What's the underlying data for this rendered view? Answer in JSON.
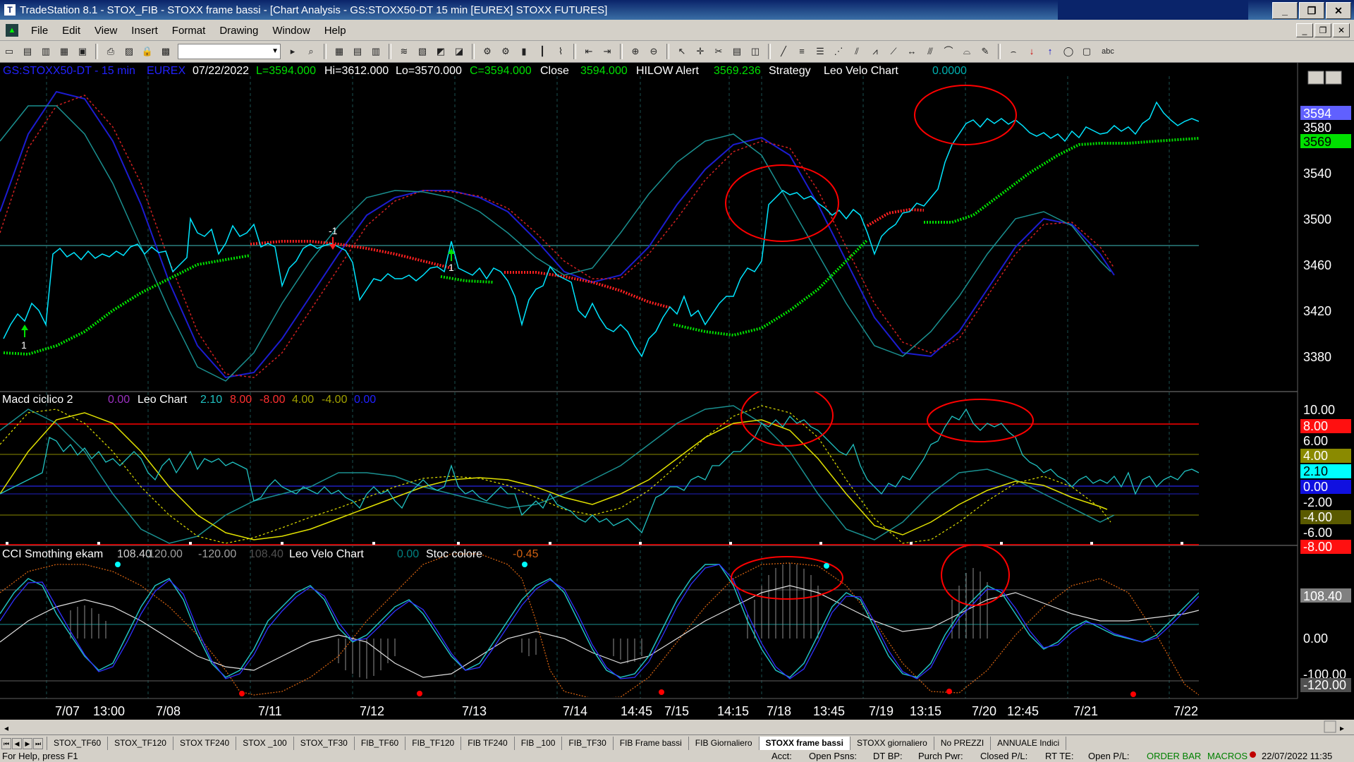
{
  "window": {
    "title": "TradeStation 8.1 - STOX_FIB - STOXX frame bassi - [Chart Analysis - GS:STOXX50-DT  15 min  [EUREX] STOXX FUTURES]",
    "buttons": [
      "_",
      "❐",
      "✕"
    ]
  },
  "menu": {
    "items": [
      "File",
      "Edit",
      "View",
      "Insert",
      "Format",
      "Drawing",
      "Window",
      "Help"
    ],
    "mdi_buttons": [
      "_",
      "❐",
      "✕"
    ]
  },
  "toolbar": {
    "select_value": "",
    "text_tool_label": "abc"
  },
  "chart": {
    "header": {
      "symbol": "GS:STOXX50-DT - 15 min",
      "exchange": "EUREX",
      "date": "07/22/2022",
      "last": "L=3594.000",
      "high": "Hi=3612.000",
      "low": "Lo=3570.000",
      "close_eq": "C=3594.000",
      "close_label": "Close",
      "close_val": "3594.000",
      "hilow_label": "HILOW Alert",
      "hilow_val": "3569.236",
      "strategy_label": "Strategy",
      "velo_label": "Leo Velo Chart",
      "velo_val": "0.0000"
    },
    "price_axis": {
      "ticks": [
        "3580",
        "3540",
        "3500",
        "3460",
        "3420",
        "3380"
      ],
      "last_price": "3594",
      "hilow_price": "3569"
    },
    "markers": {
      "down_label": "-1",
      "up_label_1": "1",
      "up_label_2": "1"
    },
    "macd_header": {
      "name": "Macd ciclico 2",
      "v0": "0.00",
      "leo_label": "Leo Chart",
      "v1": "2.10",
      "v2": "8.00",
      "v3": "-8.00",
      "v4": "4.00",
      "v5": "-4.00",
      "v6": "0.00"
    },
    "macd_axis": [
      "10.00",
      "8.00",
      "6.00",
      "4.00",
      "2.10",
      "0.00",
      "-2.00",
      "-4.00",
      "-6.00",
      "-8.00"
    ],
    "cci_header": {
      "name": "CCI Smothing ekam",
      "v1": "108.40",
      "v2": "120.00",
      "v3": "-120.00",
      "v4": "108.40",
      "velo_label": "Leo Velo Chart",
      "velo_val": "0.00",
      "stoc_label": "Stoc colore",
      "stoc_val": "-0.45"
    },
    "cci_axis": [
      "108.40",
      "0.00",
      "-100.00",
      "-120.00"
    ],
    "time_axis": [
      "7/07",
      "13:00",
      "7/08",
      "7/11",
      "7/12",
      "7/13",
      "7/14",
      "14:45",
      "7/15",
      "14:15",
      "7/18",
      "13:45",
      "7/19",
      "13:15",
      "7/20",
      "12:45",
      "7/21",
      "7/22"
    ]
  },
  "tabs": [
    "STOX_TF60",
    "STOX_TF120",
    "STOX TF240",
    "STOX _100",
    "STOX_TF30",
    "FIB_TF60",
    "FIB_TF120",
    "FIB TF240",
    "FIB _100",
    "FIB_TF30",
    "FIB Frame bassi",
    "FIB Giornaliero",
    "STOXX frame bassi",
    "STOXX giornaliero",
    "No PREZZI",
    "ANNUALE Indici"
  ],
  "active_tab": "STOXX frame bassi",
  "status": {
    "help": "For Help, press F1",
    "acct": "Acct:",
    "open_psns": "Open Psns:",
    "dt_bp": "DT BP:",
    "purch_pwr": "Purch Pwr:",
    "closed_pl": "Closed P/L:",
    "rt_te": "RT TE:",
    "open_pl": "Open P/L:",
    "order_bar": "ORDER BAR",
    "macros": "MACROS",
    "datetime": "22/07/2022 11:35"
  },
  "colors": {
    "price": "#00e5ff",
    "hilow_up": "#00ff00",
    "hilow_down": "#ff2020",
    "annotation": "#ff0000",
    "last_price_bg": "#6060ff",
    "hilow_bg": "#00e000"
  }
}
